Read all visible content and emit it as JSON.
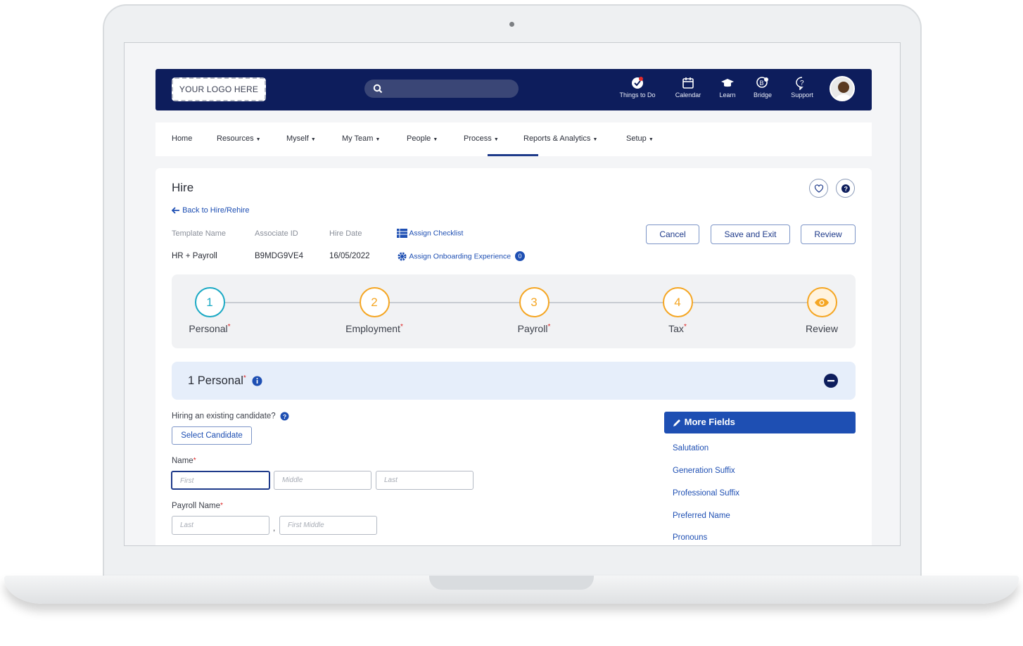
{
  "topbar": {
    "logo_text": "YOUR LOGO HERE",
    "search_placeholder": "",
    "items": [
      {
        "label": "Things to Do",
        "icon": "check-badge-icon"
      },
      {
        "label": "Calendar",
        "icon": "calendar-icon"
      },
      {
        "label": "Learn",
        "icon": "graduation-cap-icon"
      },
      {
        "label": "Bridge",
        "icon": "bridge-chat-icon"
      },
      {
        "label": "Support",
        "icon": "help-bubble-icon"
      }
    ]
  },
  "nav": {
    "items": [
      "Home",
      "Resources",
      "Myself",
      "My Team",
      "People",
      "Process",
      "Reports & Analytics",
      "Setup"
    ],
    "active": "Process"
  },
  "page": {
    "title": "Hire",
    "back_link": "Back to Hire/Rehire",
    "meta": {
      "template_name_label": "Template Name",
      "template_name_value": "HR + Payroll",
      "associate_id_label": "Associate ID",
      "associate_id_value": "B9MDG9VE4",
      "hire_date_label": "Hire Date",
      "hire_date_value": "16/05/2022"
    },
    "assign_checklist": "Assign Checklist",
    "assign_onboarding": "Assign Onboarding Experience",
    "onboarding_count": "0",
    "buttons": {
      "cancel": "Cancel",
      "save_exit": "Save and Exit",
      "review": "Review"
    }
  },
  "stepper": {
    "steps": [
      {
        "number": "1",
        "label": "Personal",
        "required": "*"
      },
      {
        "number": "2",
        "label": "Employment",
        "required": "*"
      },
      {
        "number": "3",
        "label": "Payroll",
        "required": "*"
      },
      {
        "number": "4",
        "label": "Tax",
        "required": "*"
      },
      {
        "number": "",
        "label": "Review",
        "required": ""
      }
    ],
    "colors": {
      "active": "#1aa9c4",
      "pending": "#f5a623"
    }
  },
  "section": {
    "title": "1 Personal",
    "required": "*"
  },
  "form": {
    "existing_candidate_label": "Hiring an existing candidate?",
    "select_candidate": "Select Candidate",
    "name_label": "Name",
    "name_required": "*",
    "first_placeholder": "First",
    "middle_placeholder": "Middle",
    "last_placeholder": "Last",
    "payroll_name_label": "Payroll Name",
    "payroll_required": "*",
    "payroll_last_placeholder": "Last",
    "payroll_separator": ",",
    "payroll_first_middle_placeholder": "First Middle"
  },
  "more_fields": {
    "title": "More Fields",
    "links": [
      "Salutation",
      "Generation Suffix",
      "Professional Suffix",
      "Preferred Name",
      "Pronouns"
    ]
  }
}
